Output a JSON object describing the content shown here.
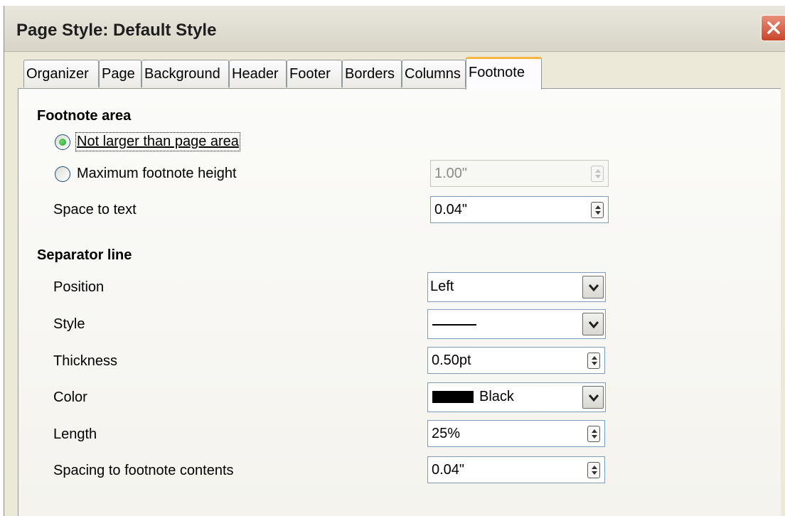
{
  "window": {
    "title": "Page Style: Default Style"
  },
  "tabs": [
    "Organizer",
    "Page",
    "Background",
    "Header",
    "Footer",
    "Borders",
    "Columns",
    "Footnote"
  ],
  "active_tab": "Footnote",
  "footnote_area": {
    "title": "Footnote area",
    "option_not_larger": "Not larger than page area",
    "option_max_height": "Maximum footnote height",
    "max_height_value": "1.00\"",
    "space_to_text_label": "Space to text",
    "space_to_text_value": "0.04\"",
    "selected_option": "Not larger than page area"
  },
  "separator": {
    "title": "Separator line",
    "position_label": "Position",
    "position_value": "Left",
    "style_label": "Style",
    "style_value": "solid line",
    "thickness_label": "Thickness",
    "thickness_value": "0.50pt",
    "color_label": "Color",
    "color_value": "Black",
    "color_hex": "#000000",
    "length_label": "Length",
    "length_value": "25%",
    "spacing_label": "Spacing to footnote contents",
    "spacing_value": "0.04\""
  },
  "colors": {
    "accent_tab": "#f5b642",
    "close_button": "#c8452a",
    "radio_selected": "#21a121"
  },
  "icons": [
    "close-icon",
    "spin-up-down-icon",
    "dropdown-arrow-icon"
  ]
}
